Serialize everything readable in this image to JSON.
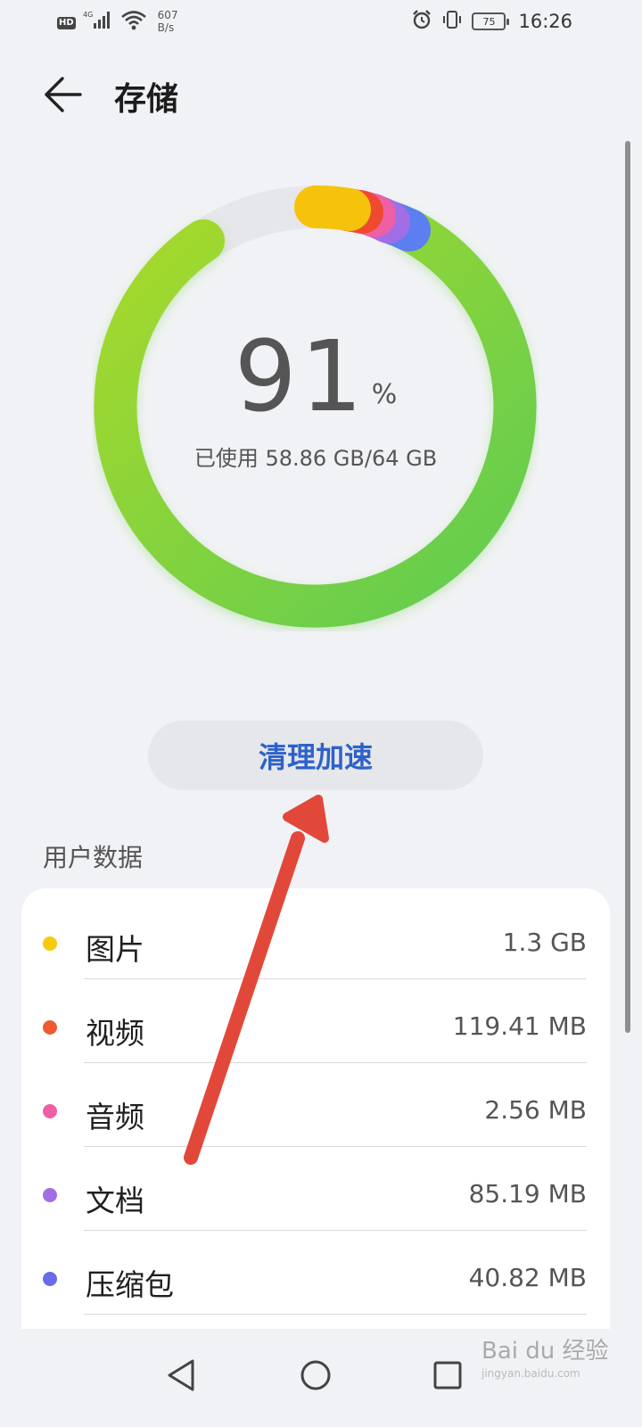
{
  "status_bar": {
    "hd_badge": "HD",
    "network_badge": "4G",
    "net_speed_value": "607",
    "net_speed_unit": "B/s",
    "battery_level": "75",
    "time": "16:26"
  },
  "header": {
    "title": "存储"
  },
  "storage": {
    "percent": "91",
    "percent_unit": "%",
    "used_text": "已使用 58.86 GB/64 GB"
  },
  "actions": {
    "clean_button": "清理加速"
  },
  "user_data": {
    "section_title": "用户数据",
    "items": [
      {
        "label": "图片",
        "value": "1.3 GB",
        "color": "#f6c90b"
      },
      {
        "label": "视频",
        "value": "119.41 MB",
        "color": "#ef5a33"
      },
      {
        "label": "音频",
        "value": "2.56 MB",
        "color": "#ef5fa4"
      },
      {
        "label": "文档",
        "value": "85.19 MB",
        "color": "#a16ee6"
      },
      {
        "label": "压缩包",
        "value": "40.82 MB",
        "color": "#6a6be6"
      }
    ]
  },
  "watermark": {
    "main": "Bai du 经验",
    "sub": "jingyan.baidu.com"
  },
  "colors": {
    "accent": "#2d62c9",
    "ring_green": "#7dd63a",
    "arrow": "#e2483a"
  }
}
